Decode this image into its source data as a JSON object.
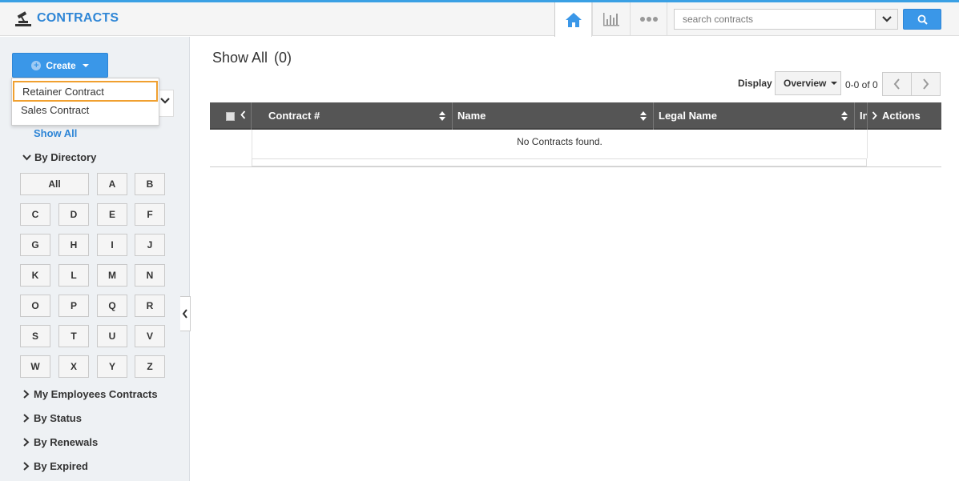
{
  "header": {
    "title": "CONTRACTS",
    "search": {
      "placeholder": "search contracts"
    }
  },
  "sidebar": {
    "create_label": "Create",
    "create_menu": [
      "Retainer Contract",
      "Sales Contract"
    ],
    "show_all": "Show All",
    "by_directory": "By Directory",
    "letters": [
      "All",
      "A",
      "B",
      "C",
      "D",
      "E",
      "F",
      "G",
      "H",
      "I",
      "J",
      "K",
      "L",
      "M",
      "N",
      "O",
      "P",
      "Q",
      "R",
      "S",
      "T",
      "U",
      "V",
      "W",
      "X",
      "Y",
      "Z"
    ],
    "sections": [
      "My Employees Contracts",
      "By Status",
      "By Renewals",
      "By Expired"
    ]
  },
  "main": {
    "heading": "Show All",
    "count": "(0)",
    "display_label": "Display",
    "display_value": "Overview",
    "range": "0-0 of 0",
    "columns": {
      "contract": "Contract #",
      "name": "Name",
      "legal": "Legal Name",
      "in": "In",
      "actions": "Actions"
    },
    "empty_message": "No Contracts found."
  },
  "colors": {
    "accent": "#3a97e8",
    "title": "#2f86d6",
    "table_header": "#555555",
    "sidebar_bg": "#eef1f4",
    "selected_outline": "#f0a030"
  }
}
